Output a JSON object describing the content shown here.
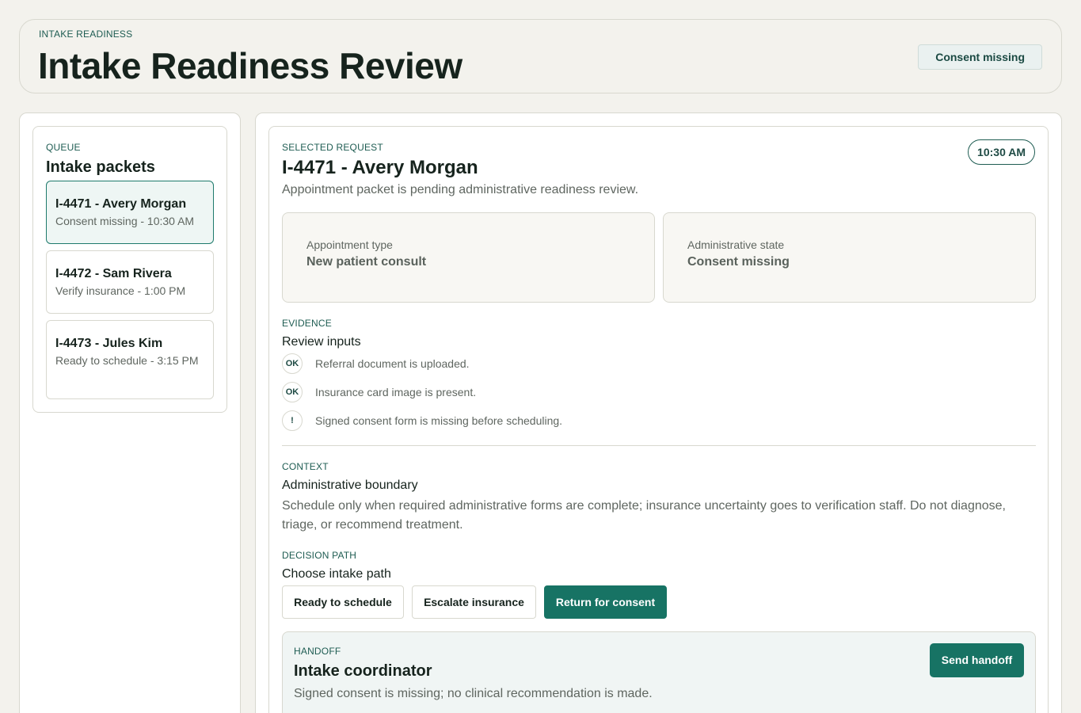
{
  "header": {
    "eyebrow": "INTAKE READINESS",
    "title": "Intake Readiness Review",
    "badge": "Consent missing"
  },
  "queue": {
    "eyebrow": "QUEUE",
    "title": "Intake packets",
    "items": [
      {
        "title": "I-4471 - Avery Morgan",
        "sub": "Consent missing - 10:30 AM",
        "selected": true
      },
      {
        "title": "I-4472 - Sam Rivera",
        "sub": "Verify insurance - 1:00 PM",
        "selected": false
      },
      {
        "title": "I-4473 - Jules Kim",
        "sub": "Ready to schedule - 3:15 PM",
        "selected": false
      }
    ]
  },
  "request": {
    "eyebrow": "SELECTED REQUEST",
    "title": "I-4471 - Avery Morgan",
    "description": "Appointment packet is pending administrative readiness review.",
    "time": "10:30 AM",
    "appointment_type_label": "Appointment type",
    "appointment_type_value": "New patient consult",
    "admin_state_label": "Administrative state",
    "admin_state_value": "Consent missing"
  },
  "evidence": {
    "eyebrow": "EVIDENCE",
    "title": "Review inputs",
    "items": [
      {
        "icon": "OK",
        "text": "Referral document is uploaded."
      },
      {
        "icon": "OK",
        "text": "Insurance card image is present."
      },
      {
        "icon": "!",
        "text": "Signed consent form is missing before scheduling."
      }
    ]
  },
  "context": {
    "eyebrow": "CONTEXT",
    "title": "Administrative boundary",
    "text": "Schedule only when required administrative forms are complete; insurance uncertainty goes to verification staff. Do not diagnose, triage, or recommend treatment."
  },
  "decision": {
    "eyebrow": "DECISION PATH",
    "title": "Choose intake path",
    "ready_label": "Ready to schedule",
    "escalate_label": "Escalate insurance",
    "return_label": "Return for consent"
  },
  "handoff": {
    "eyebrow": "HANDOFF",
    "title": "Intake coordinator",
    "text": "Signed consent is missing; no clinical recommendation is made.",
    "send_label": "Send handoff"
  },
  "colors": {
    "accent": "#177364",
    "background": "#f3f2ed"
  }
}
